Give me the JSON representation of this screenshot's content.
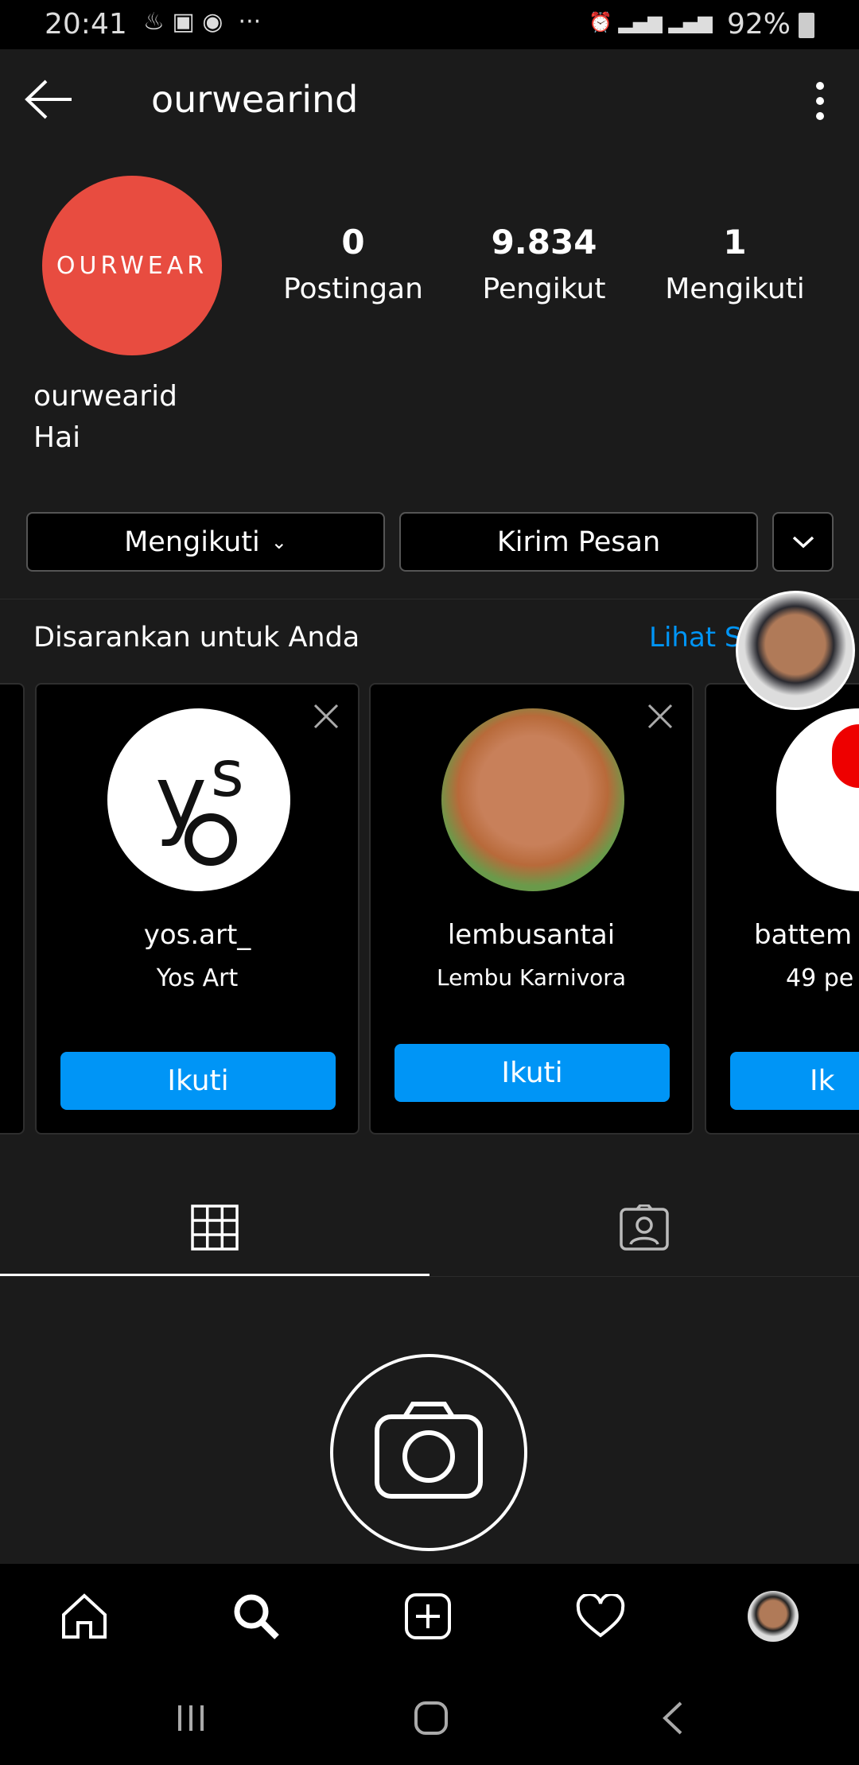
{
  "status": {
    "time": "20:41",
    "battery": "92%"
  },
  "header": {
    "title": "ourwearind"
  },
  "profile": {
    "avatar_text": "OURWEAR",
    "avatar_color": "#e84c40",
    "name": "ourwearid",
    "bio": "Hai",
    "stats": [
      {
        "value": "0",
        "label": "Postingan"
      },
      {
        "value": "9.834",
        "label": "Pengikut"
      },
      {
        "value": "1",
        "label": "Mengikuti"
      }
    ]
  },
  "actions": {
    "following": "Mengikuti",
    "message": "Kirim Pesan"
  },
  "suggested": {
    "title": "Disarankan untuk Anda",
    "see_all": "Lihat Semua",
    "cards": [
      {
        "username": "yos.art_",
        "subtitle": "Yos Art",
        "follow": "Ikuti"
      },
      {
        "username": "lembusantai",
        "subtitle": "Lembu Karnivora",
        "follow": "Ikuti"
      },
      {
        "username": "battem",
        "subtitle": "49 pe",
        "follow": "Ik"
      }
    ]
  },
  "accent": "#0095f6"
}
